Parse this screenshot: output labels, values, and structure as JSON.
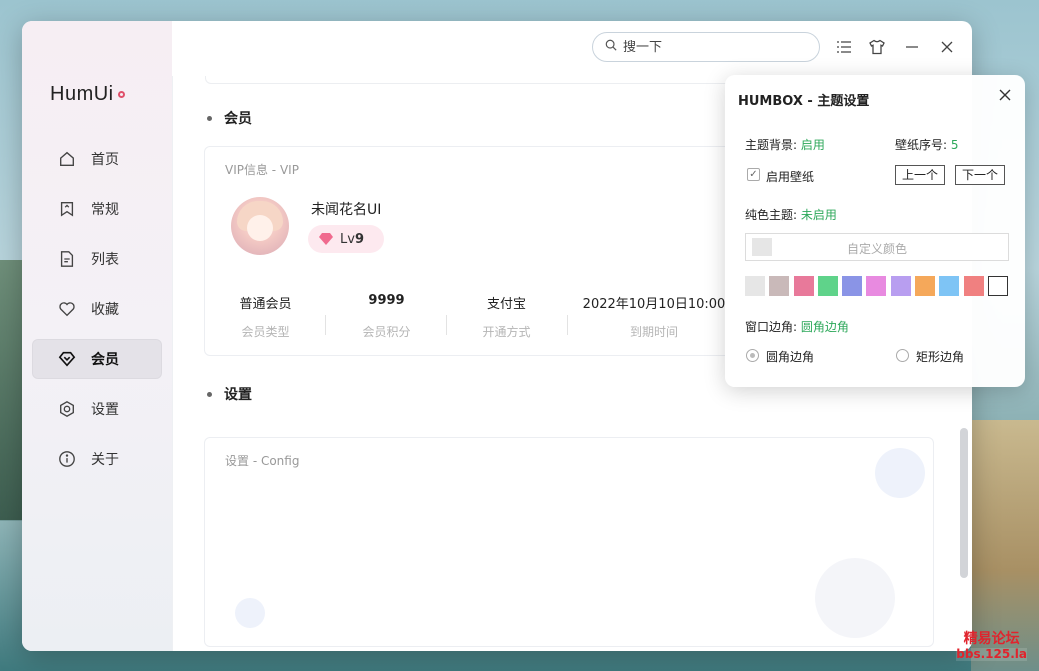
{
  "app": {
    "brand": "HumUi"
  },
  "titlebar": {
    "search_placeholder": "搜一下",
    "icons": [
      "search-icon",
      "list-icon",
      "tshirt-icon",
      "minimize-icon",
      "close-icon"
    ]
  },
  "sidebar": {
    "items": [
      {
        "label": "首页",
        "icon": "home-icon",
        "active": false
      },
      {
        "label": "常规",
        "icon": "bookmark-icon",
        "active": false
      },
      {
        "label": "列表",
        "icon": "document-icon",
        "active": false
      },
      {
        "label": "收藏",
        "icon": "heart-icon",
        "active": false
      },
      {
        "label": "会员",
        "icon": "diamond-icon",
        "active": true
      },
      {
        "label": "设置",
        "icon": "settings-icon",
        "active": false
      },
      {
        "label": "关于",
        "icon": "info-icon",
        "active": false
      }
    ]
  },
  "member_section": {
    "title": "会员",
    "caption": "VIP信息 - VIP",
    "user_name": "未闻花名UI",
    "level_prefix": "Lv",
    "level_value": "9",
    "stats": [
      {
        "value": "普通会员",
        "label": "会员类型"
      },
      {
        "value": "9999",
        "label": "会员积分"
      },
      {
        "value": "支付宝",
        "label": "开通方式"
      },
      {
        "value": "2022年10月10日10:00",
        "label": "到期时间"
      }
    ]
  },
  "settings_section": {
    "title": "设置",
    "caption": "设置 - Config"
  },
  "theme_popup": {
    "title": "HUMBOX - 主题设置",
    "bg_label": "主题背景:",
    "bg_value": "启用",
    "wallpaper_no_label": "壁纸序号:",
    "wallpaper_no_value": "5",
    "enable_wallpaper_label": "启用壁纸",
    "enable_wallpaper_checked": true,
    "prev_label": "上一个",
    "next_label": "下一个",
    "solid_label": "纯色主题:",
    "solid_value": "未启用",
    "custom_color_placeholder": "自定义颜色",
    "palette": [
      "#e6e6e6",
      "#c9b9b9",
      "#e8799a",
      "#5fd38a",
      "#8a94e6",
      "#e88ae0",
      "#b89ef0",
      "#f5a85a",
      "#7ec4f5",
      "#f08080",
      "#ffffff"
    ],
    "corner_label": "窗口边角:",
    "corner_value": "圆角边角",
    "corner_options": [
      {
        "label": "圆角边角",
        "checked": true
      },
      {
        "label": "矩形边角",
        "checked": false
      }
    ]
  },
  "watermark": {
    "line1": "精易论坛",
    "line2": "bbs.125.la"
  }
}
